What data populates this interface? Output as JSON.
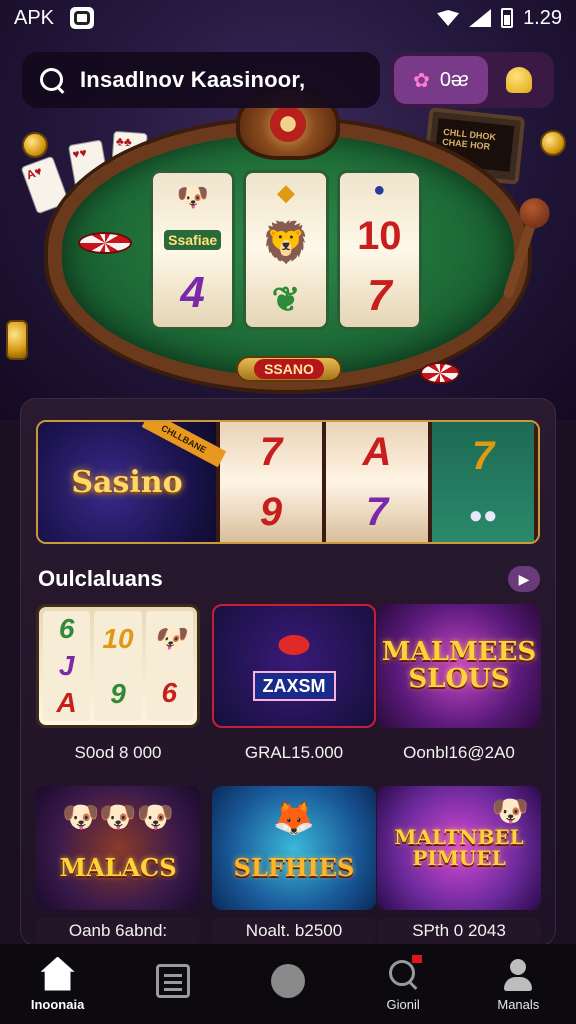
{
  "status_bar": {
    "app_label": "APK",
    "time": "1.29"
  },
  "header": {
    "search_text": "Insadlnov Kaasinoor,",
    "pill_icon": "spin-icon",
    "pill_text": "0ᴂ",
    "bell_icon": "bell-icon"
  },
  "hero": {
    "plaque_text": "SSANO",
    "monitor_text": "CHLL DHOK\nCHAE HOR",
    "reels": [
      [
        "",
        "Ssafiae",
        "4"
      ],
      [
        "",
        "",
        ""
      ],
      [
        "",
        "10",
        "7"
      ]
    ]
  },
  "banner": {
    "logo_text": "Sasino",
    "ribbon_text": "CHLLBANE",
    "reels": [
      [
        "7",
        "9"
      ],
      [
        "A",
        "7"
      ],
      [
        "7",
        ""
      ]
    ]
  },
  "section": {
    "title": "Oulclaluans",
    "arrow_icon": "arrow-right-icon"
  },
  "games": [
    {
      "title": "",
      "caption": "S0od 8 000",
      "reels": [
        [
          "6",
          "J",
          "A"
        ],
        [
          "10",
          "9",
          ""
        ],
        [
          "",
          "",
          "6"
        ]
      ]
    },
    {
      "title": "ZAXSM",
      "caption": "GRAL15.000"
    },
    {
      "title": "MALMEES SLOUS",
      "caption": "Oonbl16@2A0"
    },
    {
      "title": "MALACS",
      "caption": "Oanb 6abnd:"
    },
    {
      "title": "SLFHIES",
      "caption": "Noalt. b2500"
    },
    {
      "title": "MALTNBEL PIMUEL",
      "caption": "SPth 0 2043"
    }
  ],
  "bottom_nav": [
    {
      "label": "Inoonaia",
      "icon": "home-icon",
      "active": true
    },
    {
      "label": "",
      "icon": "list-icon",
      "active": false
    },
    {
      "label": "",
      "icon": "search-icon",
      "active": false
    },
    {
      "label": "Gionil",
      "icon": "search-alert-icon",
      "active": false
    },
    {
      "label": "Manals",
      "icon": "user-icon",
      "active": false
    }
  ],
  "colors": {
    "background": "#1b0f22",
    "panel": "#2a1a30",
    "accent_gold": "#ffd23a",
    "accent_purple": "#7a3a8a"
  }
}
